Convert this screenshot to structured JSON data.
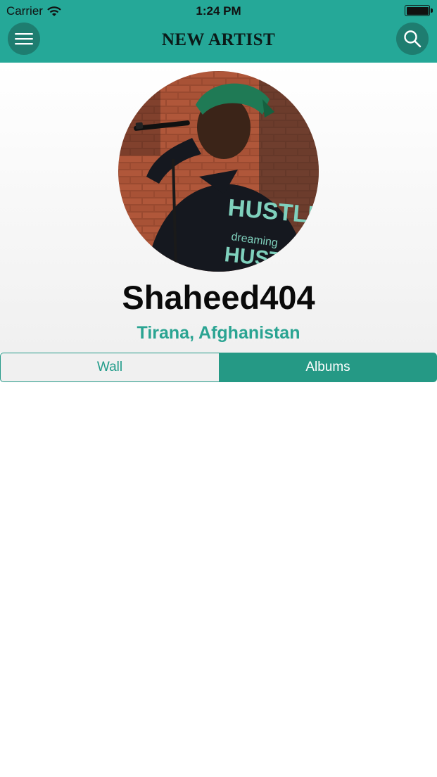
{
  "status_bar": {
    "carrier": "Carrier",
    "time": "1:24 PM",
    "wifi_icon": "wifi-icon",
    "battery_icon": "battery-icon",
    "battery_level": 1.0
  },
  "nav": {
    "title": "NEW ARTIST",
    "menu_icon": "hamburger-menu-icon",
    "search_icon": "search-icon"
  },
  "profile": {
    "name": "Shaheed404",
    "location": "Tirana, Afghanistan"
  },
  "tabs": [
    {
      "label": "Wall",
      "selected": false
    },
    {
      "label": "Albums",
      "selected": true
    }
  ],
  "colors": {
    "brand": "#25a898",
    "brand_dark": "#1e7d70",
    "tab_selected": "#259985",
    "location_text": "#2aa492"
  }
}
